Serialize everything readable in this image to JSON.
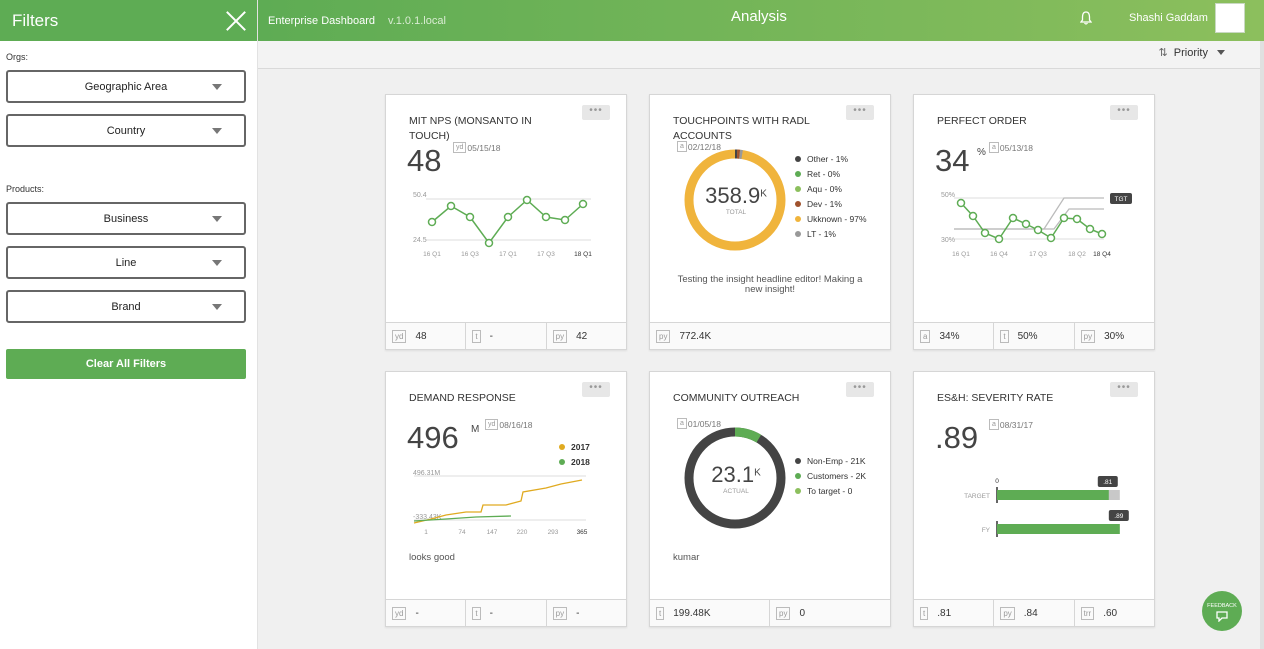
{
  "sidebar": {
    "title": "Filters",
    "orgs_label": "Orgs:",
    "orgs": [
      "Geographic Area",
      "Country"
    ],
    "products_label": "Products:",
    "products": [
      "Business",
      "Line",
      "Brand"
    ],
    "clear_label": "Clear All Filters"
  },
  "header": {
    "brand": "Enterprise Dashboard",
    "version": "v.1.0.1.local",
    "title": "Analysis",
    "user": "Shashi Gaddam"
  },
  "sort": {
    "label": "Priority"
  },
  "feedback": {
    "label": "FEEDBACK"
  },
  "cards": {
    "nps": {
      "title": "MIT NPS (MONSANTO IN TOUCH)",
      "value": "48",
      "meta_tag": "yd",
      "meta_date": "05/15/18",
      "chart": {
        "type": "line",
        "ymax_label": "50.4",
        "ymin_label": "24.5",
        "xticks": [
          "16 Q1",
          "16 Q3",
          "17 Q1",
          "17 Q3",
          "18 Q1"
        ]
      },
      "footer": [
        {
          "tag": "yd",
          "value": "48"
        },
        {
          "tag": "t",
          "value": "-"
        },
        {
          "tag": "py",
          "value": "42"
        }
      ]
    },
    "touchpoints": {
      "title": "TOUCHPOINTS WITH RADL ACCOUNTS",
      "meta_tag": "a",
      "meta_date": "02/12/18",
      "center_value": "358.9",
      "center_unit": "K",
      "center_label": "TOTAL",
      "legend": [
        {
          "label": "Other - 1%",
          "color": "#444444"
        },
        {
          "label": "Ret - 0%",
          "color": "#5eac54"
        },
        {
          "label": "Aqu - 0%",
          "color": "#8cbf5d"
        },
        {
          "label": "Dev - 1%",
          "color": "#a0522d"
        },
        {
          "label": "Ukknown - 97%",
          "color": "#f0b43c"
        },
        {
          "label": "LT - 1%",
          "color": "#999999"
        }
      ],
      "note": "Testing the insight headline editor! Making a new insight!",
      "footer": [
        {
          "tag": "py",
          "value": "772.4K"
        }
      ]
    },
    "perfect": {
      "title": "PERFECT ORDER",
      "value": "34",
      "unit": "%",
      "meta_tag": "a",
      "meta_date": "05/13/18",
      "target_label": "TGT",
      "chart": {
        "type": "line",
        "ymax_label": "50%",
        "ymin_label": "30%",
        "xticks": [
          "16 Q1",
          "16 Q4",
          "17 Q3",
          "18 Q2",
          "18 Q4"
        ]
      },
      "footer": [
        {
          "tag": "a",
          "value": "34%"
        },
        {
          "tag": "t",
          "value": "50%"
        },
        {
          "tag": "py",
          "value": "30%"
        }
      ]
    },
    "demand": {
      "title": "DEMAND RESPONSE",
      "value": "496",
      "unit": "M",
      "meta_tag": "yd",
      "meta_date": "08/16/18",
      "legend": [
        {
          "label": "2017",
          "color": "#e0aa20"
        },
        {
          "label": "2018",
          "color": "#5eac54"
        }
      ],
      "chart": {
        "ymax_label": "496.31M",
        "ymin_label": "-333.43K",
        "xticks": [
          "1",
          "74",
          "147",
          "220",
          "293",
          "365"
        ]
      },
      "note": "looks good",
      "footer": [
        {
          "tag": "yd",
          "value": "-"
        },
        {
          "tag": "t",
          "value": "-"
        },
        {
          "tag": "py",
          "value": "-"
        }
      ]
    },
    "community": {
      "title": "COMMUNITY OUTREACH",
      "meta_tag": "a",
      "meta_date": "01/05/18",
      "center_value": "23.1",
      "center_unit": "K",
      "center_label": "ACTUAL",
      "legend": [
        {
          "label": "Non-Emp - 21K",
          "color": "#444444"
        },
        {
          "label": "Customers - 2K",
          "color": "#5eac54"
        },
        {
          "label": "To target - 0",
          "color": "#8cbf5d"
        }
      ],
      "note": "kumar",
      "footer": [
        {
          "tag": "t",
          "value": "199.48K"
        },
        {
          "tag": "py",
          "value": "0"
        }
      ]
    },
    "esh": {
      "title": "ES&H: SEVERITY RATE",
      "value": ".89",
      "meta_tag": "a",
      "meta_date": "08/31/17",
      "bars": {
        "zero_label": "0",
        "rows": [
          {
            "label": "TARGET",
            "value": 0.81,
            "value_label": ".81"
          },
          {
            "label": "FY",
            "value": 0.89,
            "value_label": ".89"
          }
        ]
      },
      "footer": [
        {
          "tag": "t",
          "value": ".81"
        },
        {
          "tag": "py",
          "value": ".84"
        },
        {
          "tag": "trr",
          "value": ".60"
        }
      ]
    }
  }
}
